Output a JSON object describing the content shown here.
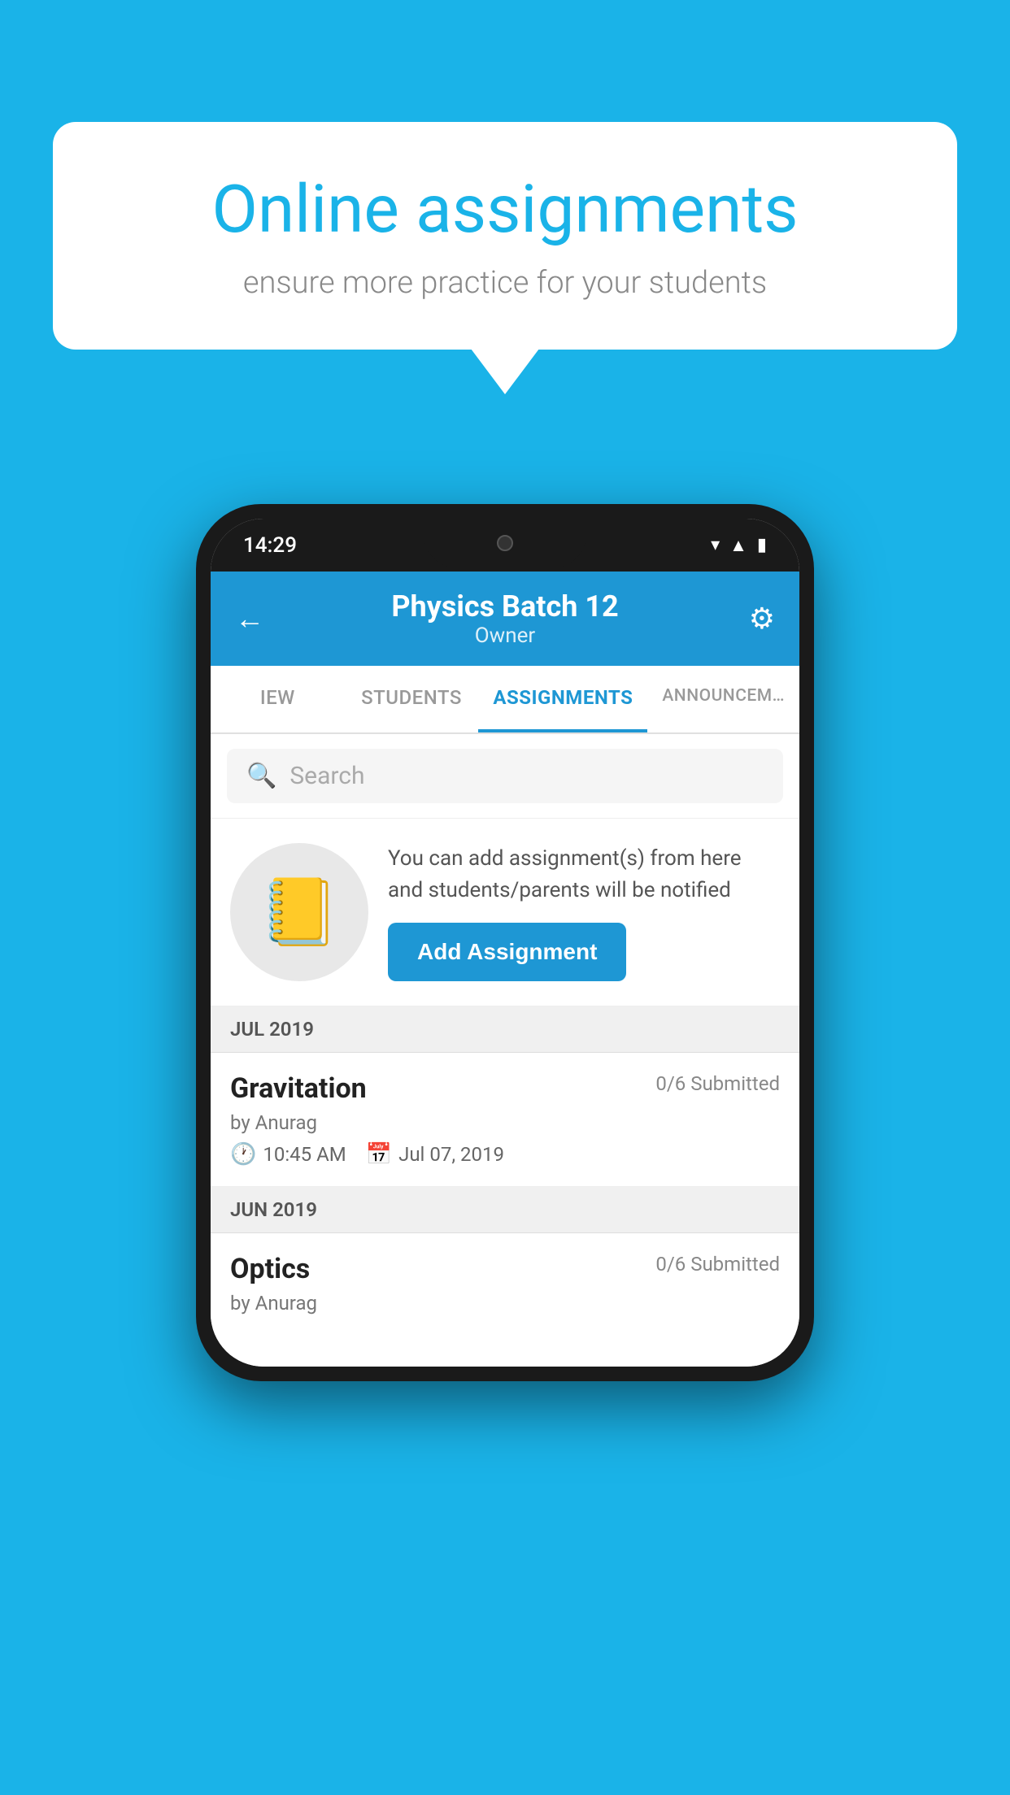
{
  "background": {
    "color": "#1ab3e8"
  },
  "speech_bubble": {
    "title": "Online assignments",
    "subtitle": "ensure more practice for your students"
  },
  "phone": {
    "status_bar": {
      "time": "14:29",
      "icons": [
        "wifi",
        "signal",
        "battery"
      ]
    },
    "header": {
      "title": "Physics Batch 12",
      "subtitle": "Owner",
      "back_label": "←",
      "settings_label": "⚙"
    },
    "tabs": [
      {
        "label": "IEW",
        "active": false
      },
      {
        "label": "STUDENTS",
        "active": false
      },
      {
        "label": "ASSIGNMENTS",
        "active": true
      },
      {
        "label": "ANNOUNCEM…",
        "active": false
      }
    ],
    "search": {
      "placeholder": "Search"
    },
    "promo": {
      "description": "You can add assignment(s) from here and students/parents will be notified",
      "button_label": "Add Assignment"
    },
    "sections": [
      {
        "month_label": "JUL 2019",
        "assignments": [
          {
            "title": "Gravitation",
            "submitted": "0/6 Submitted",
            "by": "by Anurag",
            "time": "10:45 AM",
            "date": "Jul 07, 2019"
          }
        ]
      },
      {
        "month_label": "JUN 2019",
        "assignments": [
          {
            "title": "Optics",
            "submitted": "0/6 Submitted",
            "by": "by Anurag",
            "time": "",
            "date": ""
          }
        ]
      }
    ]
  }
}
